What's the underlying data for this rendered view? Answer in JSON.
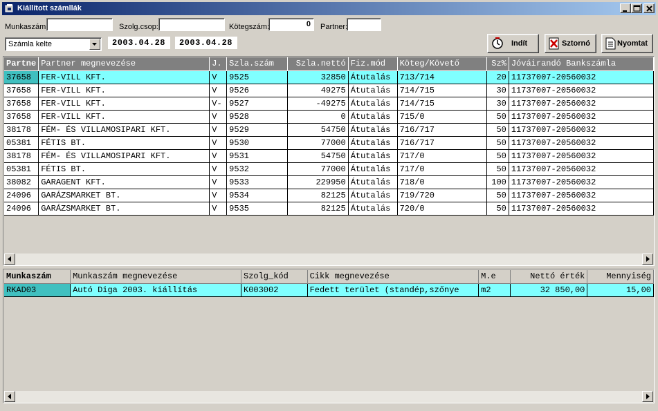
{
  "window": {
    "title": "Kiállított számllák"
  },
  "filters": {
    "munkaszam_label": "Munkaszám:",
    "munkaszam_value": "",
    "szolg_label": "Szolg.csop:",
    "szolg_value": "",
    "koteg_label": "Kötegszám:",
    "koteg_value": "0",
    "partner_label": "Partner:",
    "partner_value": "",
    "date_type_selected": "Számla kelte",
    "date_from": "2003.04.28",
    "date_to": "2003.04.28"
  },
  "buttons": {
    "start": "Indít",
    "storno": "Sztornó",
    "print": "Nyomtat"
  },
  "invoices": {
    "headers": [
      "Partne",
      "Partner megnevezése",
      "J.",
      "Szla.szám",
      "Szla.nettó",
      "Fiz.mód",
      "Köteg/Követő",
      "Sz%",
      "Jóváirandó Bankszámla"
    ],
    "rows": [
      [
        "37658",
        "FER-VILL KFT.",
        "V",
        "9525",
        "32850",
        "Átutalás",
        "713/714",
        "20",
        "11737007-20560032"
      ],
      [
        "37658",
        "FER-VILL KFT.",
        "V",
        "9526",
        "49275",
        "Átutalás",
        "714/715",
        "30",
        "11737007-20560032"
      ],
      [
        "37658",
        "FER-VILL KFT.",
        "V-",
        "9527",
        "-49275",
        "Átutalás",
        "714/715",
        "30",
        "11737007-20560032"
      ],
      [
        "37658",
        "FER-VILL KFT.",
        "V",
        "9528",
        "0",
        "Átutalás",
        "715/0",
        "50",
        "11737007-20560032"
      ],
      [
        "38178",
        "FÉM- ÉS VILLAMOSIPARI KFT.",
        "V",
        "9529",
        "54750",
        "Átutalás",
        "716/717",
        "50",
        "11737007-20560032"
      ],
      [
        "05381",
        "FÉTIS BT.",
        "V",
        "9530",
        "77000",
        "Átutalás",
        "716/717",
        "50",
        "11737007-20560032"
      ],
      [
        "38178",
        "FÉM- ÉS VILLAMOSIPARI KFT.",
        "V",
        "9531",
        "54750",
        "Átutalás",
        "717/0",
        "50",
        "11737007-20560032"
      ],
      [
        "05381",
        "FÉTIS BT.",
        "V",
        "9532",
        "77000",
        "Átutalás",
        "717/0",
        "50",
        "11737007-20560032"
      ],
      [
        "38082",
        "GARAGENT KFT.",
        "V",
        "9533",
        "229950",
        "Átutalás",
        "718/0",
        "100",
        "11737007-20560032"
      ],
      [
        "24096",
        "GARÁZSMARKET BT.",
        "V",
        "9534",
        "82125",
        "Átutalás",
        "719/720",
        "50",
        "11737007-20560032"
      ],
      [
        "24096",
        "GARÁZSMARKET BT.",
        "V",
        "9535",
        "82125",
        "Átutalás",
        "720/0",
        "50",
        "11737007-20560032"
      ]
    ]
  },
  "details": {
    "headers": [
      "Munkaszám",
      "Munkaszám megnevezése",
      "Szolg_kód",
      "Cikk megnevezése",
      "M.e",
      "Nettó érték",
      "Mennyiség"
    ],
    "rows": [
      [
        "RKAD03",
        "Autó Diga 2003. kiállítás",
        "K003002",
        "Fedett terület (standép,szőnye",
        "m2",
        "32 850,00",
        "15,00"
      ]
    ]
  }
}
